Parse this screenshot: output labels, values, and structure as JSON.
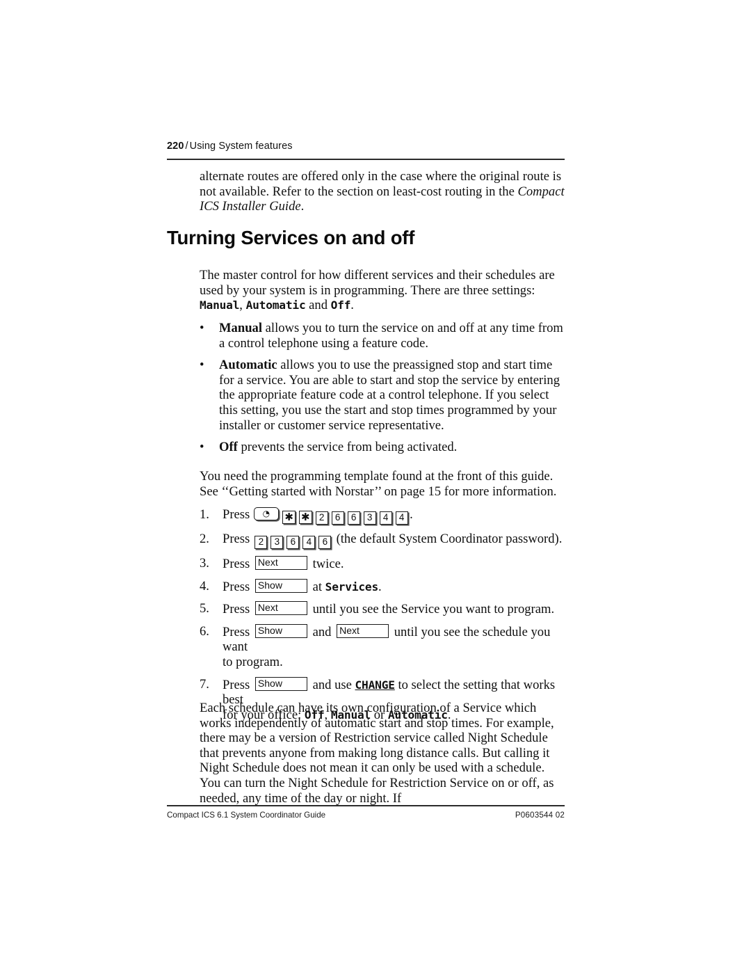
{
  "document": {
    "page_number": "220",
    "running_head_separator": "/",
    "running_head_title": "Using System features"
  },
  "intro": {
    "paragraph": "alternate routes are offered only in the case where the original route is not available. Refer to the section on least-cost routing in the ",
    "italic_reference": "Compact ICS Installer Guide",
    "period": "."
  },
  "section": {
    "title": "Turning Services on and off",
    "lead_paragraph_part1": "The master control for how different services and their schedules are used by your system is in programming. There are three settings: ",
    "setting_manual": "Manual",
    "lead_comma": ", ",
    "setting_automatic": "Automatic",
    "lead_and": " and ",
    "setting_off": "Off",
    "lead_end": "."
  },
  "bullets": [
    {
      "marker": "•",
      "lead": "Manual",
      "text": " allows you to turn the service on and off at any time from a control telephone using a feature code."
    },
    {
      "marker": "•",
      "lead": "Automatic",
      "text": " allows you to use the preassigned stop and start time for a service. You are able to start and stop the service by entering the appropriate feature code at a control telephone. If you select this setting, you use the start and stop times programmed by your installer or customer service representative."
    },
    {
      "marker": "•",
      "lead": "Off",
      "text": " prevents the service from being activated."
    }
  ],
  "template_note": "You need the programming template found at the front of this guide. See ‘‘Getting started with Norstar’’ on page 15 for more information.",
  "steps": {
    "n1": "1.",
    "n2": "2.",
    "n3": "3.",
    "n4": "4.",
    "n5": "5.",
    "n6": "6.",
    "n7": "7.",
    "press": "Press",
    "step1": {
      "feature_key_glyph": "◔",
      "keys": [
        "✱",
        "✱",
        "2",
        "6",
        "6",
        "3",
        "4",
        "4"
      ],
      "trailing": "."
    },
    "step2": {
      "keys": [
        "2",
        "3",
        "6",
        "4",
        "6"
      ],
      "trailing": "(the default System Coordinator password)."
    },
    "step3": {
      "button": "Next",
      "trailing": "twice."
    },
    "step4": {
      "button": "Show",
      "mid": "at ",
      "display_word": "Services",
      "trailing": "."
    },
    "step5": {
      "button": "Next",
      "trailing": "until you see the Service you want to program."
    },
    "step6": {
      "button_a": "Show",
      "conjunction": "and",
      "button_b": "Next",
      "trailing": "until you see the schedule you want",
      "line2": "to program."
    },
    "step7": {
      "button": "Show",
      "mid": "and use ",
      "softkey": "CHANGE",
      "after": " to select the setting that works best",
      "line2_prefix": "for your office: ",
      "opt_off": "Off",
      "line2_comma": ", ",
      "opt_manual": "Manual",
      "line2_or": " or ",
      "opt_automatic": "Automatic",
      "line2_end": "."
    }
  },
  "closing_paragraph": "Each schedule can have its own configuration of a Service which works independently of automatic start and stop times. For example, there may be a version of Restriction service called Night Schedule that prevents anyone from making long distance calls. But calling it Night Schedule does not mean it can only be used with a schedule. You can turn the Night Schedule for Restriction Service on or off, as needed, any time of the day or night. If",
  "footer": {
    "left": "Compact ICS 6.1 System Coordinator Guide",
    "right": "P0603544  02"
  }
}
